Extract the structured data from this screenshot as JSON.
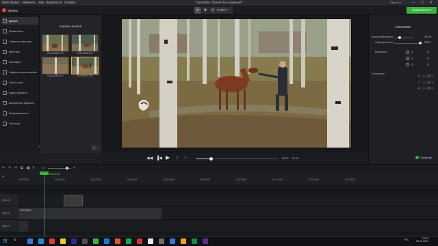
{
  "menu": {
    "items": [
      "Файл",
      "Правка",
      "Изменить",
      "Вид",
      "Поделиться",
      "Справка"
    ],
    "window_title": "Camtasia - Проект без названия*",
    "user": "Sign in ▾",
    "win_controls": [
      "—",
      "☐",
      "✕"
    ]
  },
  "toolbar": {
    "record_label": "Запись",
    "zoom_value": "70,8%",
    "export_label": "Поделиться ▾",
    "tools": [
      "pointer",
      "pan",
      "crop"
    ]
  },
  "sidebar": {
    "items": [
      {
        "label": "Данные",
        "icon": "media-icon"
      },
      {
        "label": "Примечания",
        "icon": "annotation-icon"
      },
      {
        "label": "Эффекты перехода",
        "icon": "transition-icon"
      },
      {
        "label": "Действие",
        "icon": "behavior-icon"
      },
      {
        "label": "Анимация",
        "icon": "animation-icon"
      },
      {
        "label": "Эффекты расположение",
        "icon": "cursor-effects-icon"
      },
      {
        "label": "Запись речи",
        "icon": "voice-icon"
      },
      {
        "label": "Аудио эффекты",
        "icon": "audio-effects-icon"
      },
      {
        "label": "Визуальные эффекты",
        "icon": "visual-effects-icon"
      },
      {
        "label": "Интерактивность",
        "icon": "interactivity-icon"
      },
      {
        "label": "Субтитры",
        "icon": "captions-icon"
      }
    ]
  },
  "bin": {
    "title": "Корзина клипов",
    "thumbs": [
      {
        "label": "DSC00885.JPG"
      },
      {
        "label": "DSC00886.JPG"
      },
      {
        "label": "DSC00889.JPG"
      },
      {
        "label": "DSC00891.JPG"
      }
    ]
  },
  "transport": {
    "time_current": "00:07",
    "time_total": "00:15"
  },
  "props": {
    "title": "DSC00891",
    "scale_label": "Масштабирование",
    "scale_value": "29,1%",
    "opacity_label": "Непрозрачность",
    "opacity_value": "100%",
    "rotation_label": "Вращение",
    "rotation_values": [
      "0°",
      "0°",
      "0°"
    ],
    "rotation_axes": [
      "Z",
      "Y",
      "X"
    ],
    "position_label": "Положение",
    "position_axes": [
      "X",
      "Y",
      "Z"
    ],
    "position_values": [
      "0",
      "0",
      "0"
    ],
    "properties_button": "Свойства"
  },
  "timeline": {
    "ticks": [
      "0:00:00;00",
      "0:00:10;00",
      "0:00:20;00",
      "0:00:30;00",
      "0:00:40;00",
      "0:00:50;00",
      "0:01:00;00",
      "0:01:10;00",
      "0:01:20;00",
      "0:01:30;00"
    ],
    "playhead_label": "0:00:07;18",
    "tracks": [
      {
        "label": "Трек 3"
      },
      {
        "label": "Трек 2"
      },
      {
        "label": "Трек 1"
      }
    ],
    "clips": {
      "track2": "DSC00891",
      "track1": "DSC00889"
    }
  },
  "taskbar": {
    "time": "19:25",
    "date": "29.02.2021",
    "lang": "РУС",
    "app_colors": [
      "#3a76d8",
      "#1c8cd8",
      "#dd3b2f",
      "#f2c43a",
      "#2b2e8f",
      "#4e4e4e",
      "#3bb33f",
      "#0b7fd4",
      "#e95320",
      "#1aa260",
      "#d13438",
      "#e8e8e8",
      "#6d6d6d",
      "#3a76d8",
      "#f8a000",
      "#118c4f",
      "#5a2d8c"
    ]
  },
  "colors": {
    "accent_green": "#3bb33f",
    "record_red": "#e0423c",
    "selection_orange": "#f2a93b"
  }
}
